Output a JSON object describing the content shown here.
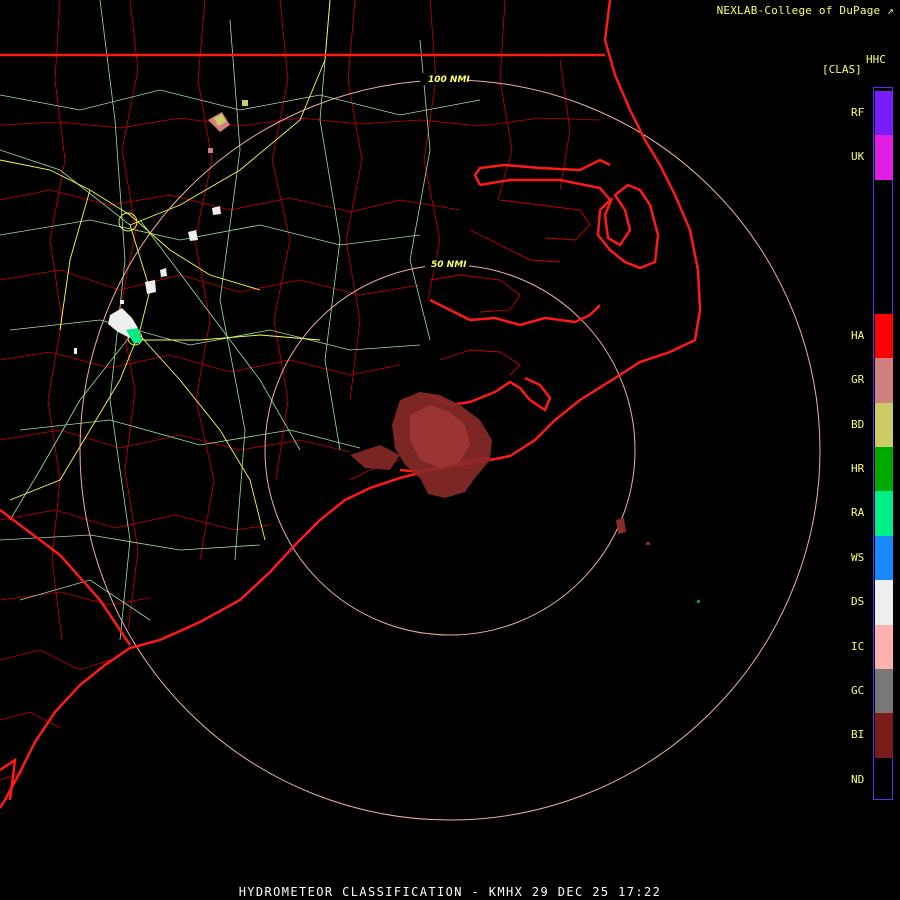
{
  "credit": "NEXLAB-College of DuPage",
  "credit_icon": "external-link-icon",
  "legend": {
    "product": "HHC",
    "title": "[CLAS]",
    "entries": [
      {
        "code": "RF",
        "color": "#7a1cff"
      },
      {
        "code": "UK",
        "color": "#e31ce3"
      },
      {
        "code": "HA",
        "color": "#ff0000"
      },
      {
        "code": "GR",
        "color": "#d08080"
      },
      {
        "code": "BD",
        "color": "#cccc66"
      },
      {
        "code": "HR",
        "color": "#00aa00"
      },
      {
        "code": "RA",
        "color": "#00ee88"
      },
      {
        "code": "WS",
        "color": "#1a88ff"
      },
      {
        "code": "DS",
        "color": "#eeeeee"
      },
      {
        "code": "IC",
        "color": "#ffb0b0"
      },
      {
        "code": "GC",
        "color": "#777777"
      },
      {
        "code": "BI",
        "color": "#7a1c1c"
      },
      {
        "code": "ND",
        "color": "#000000"
      }
    ]
  },
  "rings": {
    "inner": "50 NMI",
    "outer": "100 NMI"
  },
  "footer": "HYDROMETEOR CLASSIFICATION - KMHX 29 DEC 25 17:22",
  "colors": {
    "coast": "#ff1a1a",
    "county": "#c80000",
    "roads_green": "#9be39b",
    "roads_yellow": "#ffff44",
    "rings": "#f0b0a0",
    "echo": "#8a2a2a"
  }
}
